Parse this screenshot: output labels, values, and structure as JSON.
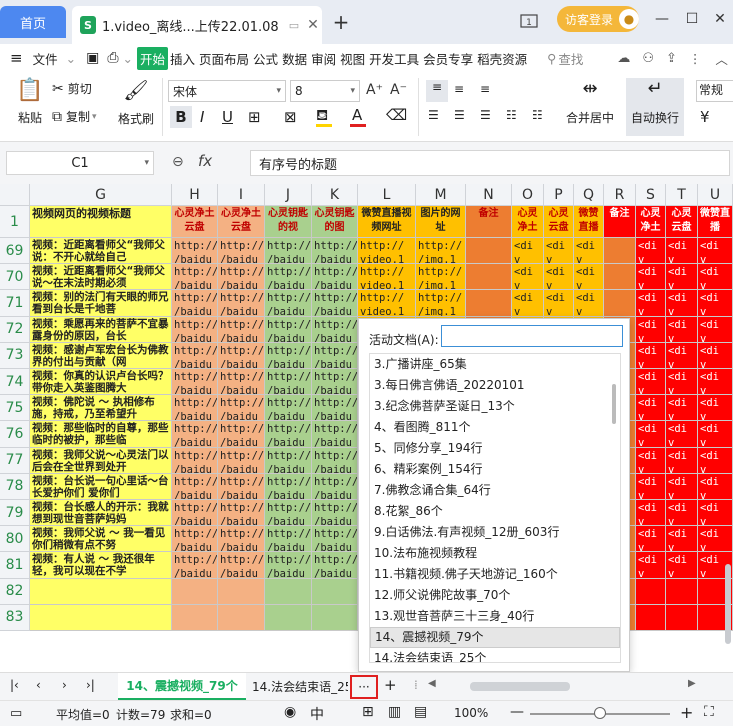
{
  "titlebar": {
    "home_tab": "首页",
    "doc_tab": "1.video_离线...上传22.01.08",
    "doc_icon": "S",
    "new_tab": "+",
    "login": "访客登录",
    "icons": [
      "window-switch-icon",
      "minimize-icon",
      "maximize-icon",
      "close-icon"
    ]
  },
  "menubar": {
    "file": "文件",
    "items": [
      "开始",
      "插入",
      "页面布局",
      "公式",
      "数据",
      "审阅",
      "视图",
      "开发工具",
      "会员专享",
      "稻壳资源"
    ],
    "search": "查找"
  },
  "ribbon": {
    "paste": "粘贴",
    "cut": "剪切",
    "copy": "复制",
    "format_painter": "格式刷",
    "font_name": "宋体",
    "font_size": "8",
    "bold": "B",
    "italic": "I",
    "underline": "U",
    "merge_center": "合并居中",
    "wrap_text": "自动换行",
    "number_format": "常规",
    "currency": "¥"
  },
  "formula": {
    "cell_ref": "C1",
    "fx": "fx",
    "content": "有序号的标题"
  },
  "grid": {
    "columns": [
      "G",
      "H",
      "I",
      "J",
      "K",
      "L",
      "M",
      "N",
      "O",
      "P",
      "Q",
      "R",
      "S",
      "T",
      "U"
    ],
    "header_row": [
      "视频网页的视频标题",
      "心灵净土云盘",
      "心灵净土云盘",
      "心灵钥匙的视",
      "心灵钥匙的图",
      "微赞直播视频网址",
      "图片的网址",
      "备注",
      "心灵净土",
      "心灵云盘",
      "微赞直播",
      "备注",
      "心灵净土",
      "心灵云盘",
      "微赞直播"
    ],
    "rows": [
      {
        "num": "69",
        "title": "视频：近距离看师父“我师父说：不开心就给自己",
        "url": "http://",
        "url2": "/baidu",
        "vurl": "http://",
        "vurl2": "video.1",
        "img": "http://",
        "img2": "/img.1"
      },
      {
        "num": "70",
        "title": "视频：近距离看师父“我师父说～在末法时期必须",
        "url": "http://",
        "url2": "/baidu",
        "vurl": "http://",
        "vurl2": "video.1",
        "img": "http://",
        "img2": "/img.1"
      },
      {
        "num": "71",
        "title": "视频：别的法门有天眼的师兄看到台长是千地菩",
        "url": "http://",
        "url2": "/baidu",
        "vurl": "http://",
        "vurl2": "video.1",
        "img": "http://",
        "img2": "/img.1"
      },
      {
        "num": "72",
        "title": "视频：乘愿再来的菩萨不宜暴露身份的原因，台长",
        "url": "http://",
        "url2": "/baidu"
      },
      {
        "num": "73",
        "title": "视频：感谢卢军宏台长为佛教界的付出与贡献（网",
        "url": "http://",
        "url2": "/baidu"
      },
      {
        "num": "74",
        "title": "视频：你真的认识卢台长吗？带你走入英鉴图腾大",
        "url": "http://",
        "url2": "/baidu"
      },
      {
        "num": "75",
        "title": "视频：佛陀说 ～ 执相修布施，持戒，乃至希望升",
        "url": "http://",
        "url2": "/baidu"
      },
      {
        "num": "76",
        "title": "视频：那些临时的自尊，那些临时的被护，那些临",
        "url": "http://",
        "url2": "/baidu"
      },
      {
        "num": "77",
        "title": "视频：我师父说～心灵法门以后会在全世界到处开",
        "url": "http://",
        "url2": "/baidu"
      },
      {
        "num": "78",
        "title": "视频：台长说一句心里话～台长爱护你们 爱你们",
        "url": "http://",
        "url2": "/baidu"
      },
      {
        "num": "79",
        "title": "视频：台长感人的开示：我就想到现世音菩萨妈妈",
        "url": "http://",
        "url2": "/baidu"
      },
      {
        "num": "80",
        "title": "视频：我师父说 ～ 我一看见你们稍微有点不努",
        "url": "http://",
        "url2": "/baidu"
      },
      {
        "num": "81",
        "title": "视频：有人说 ～ 我还很年轻，我可以现在不学",
        "url": "http://",
        "url2": "/baidu"
      },
      {
        "num": "82",
        "title": ""
      },
      {
        "num": "83",
        "title": ""
      }
    ],
    "div_text": "<di",
    "div_arrow": "v"
  },
  "dialog": {
    "label": "活动文档(A):",
    "input_value": "",
    "items": [
      "3.广播讲座_65集",
      "3.每日佛言佛语_20220101",
      "3.纪念佛菩萨圣诞日_13个",
      "4、看图腾_811个",
      "5、同修分享_194行",
      "6、精彩案例_154行",
      "7.佛教念诵合集_64行",
      "8.花絮_86个",
      "9.白话佛法.有声视频_12册_603行",
      "10.法布施视频教程",
      "11.书籍视频.佛子天地游记_160个",
      "12.师父说佛陀故事_70个",
      "13.观世音菩萨三十三身_40行",
      "14、震撼视频_79个",
      "14.法会结束语_25个"
    ],
    "selected_index": 13
  },
  "sheetbar": {
    "active_tab": "14、震撼视频_79个",
    "next_tab": "14.法会结束语_25",
    "more": "···",
    "add": "+"
  },
  "status": {
    "average": "平均值=0",
    "count": "计数=79",
    "sum": "求和=0",
    "zoom": "100%",
    "zoom_level": 0.5
  },
  "colors": {
    "accent": "#4d88f0",
    "yellow": "#ffff66",
    "peach": "#f4b183",
    "green": "#a9d08e",
    "orange": "#ed7d31",
    "gold": "#ffc000",
    "red": "#ff0000"
  }
}
